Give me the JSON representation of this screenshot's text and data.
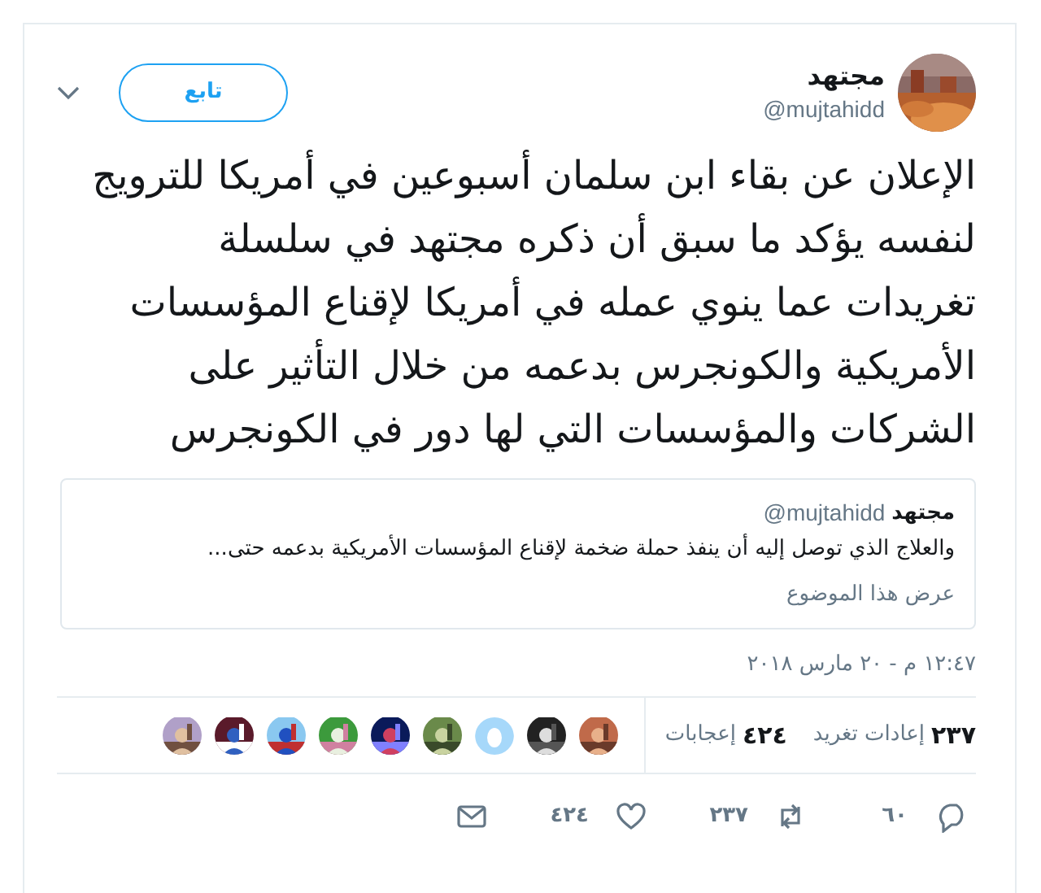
{
  "author": {
    "avatar": {
      "kind": "picture"
    },
    "name": "مجتهد",
    "handle": "@mujtahidd"
  },
  "follow_button": "تابع",
  "tweet_text": "الإعلان عن بقاء ابن سلمان أسبوعين في أمريكا للترويج لنفسه يؤكد ما سبق أن ذكره مجتهد في سلسلة تغريدات عما ينوي عمله في أمريكا لإقناع المؤسسات الأمريكية والكونجرس بدعمه من خلال التأثير على الشركات والمؤسسات التي لها دور في الكونجرس",
  "quoted": {
    "name": "مجتهد",
    "handle": "@mujtahidd",
    "text": "والعلاج الذي توصل إليه أن ينفذ حملة ضخمة لإقناع المؤسسات الأمريكية بدعمه حتى...",
    "link": "عرض هذا الموضوع"
  },
  "timestamp": "١٢:٤٧ م - ٢٠ مارس ٢٠١٨",
  "stats": [
    {
      "count": "٢٣٧",
      "label": "إعادات تغريد"
    },
    {
      "count": "٤٢٤",
      "label": "إعجابات"
    }
  ],
  "liker_avatars": [
    {
      "kind": "picture"
    },
    {
      "kind": "picture"
    },
    {
      "kind": "default"
    },
    {
      "kind": "picture"
    },
    {
      "kind": "picture"
    },
    {
      "kind": "picture"
    },
    {
      "kind": "picture"
    },
    {
      "kind": "picture"
    },
    {
      "kind": "picture"
    }
  ],
  "actions": [
    {
      "kind": "reply",
      "count": "٦٠"
    },
    {
      "kind": "retweet",
      "count": "٢٣٧"
    },
    {
      "kind": "like",
      "count": "٤٢٤"
    },
    {
      "kind": "message"
    }
  ]
}
